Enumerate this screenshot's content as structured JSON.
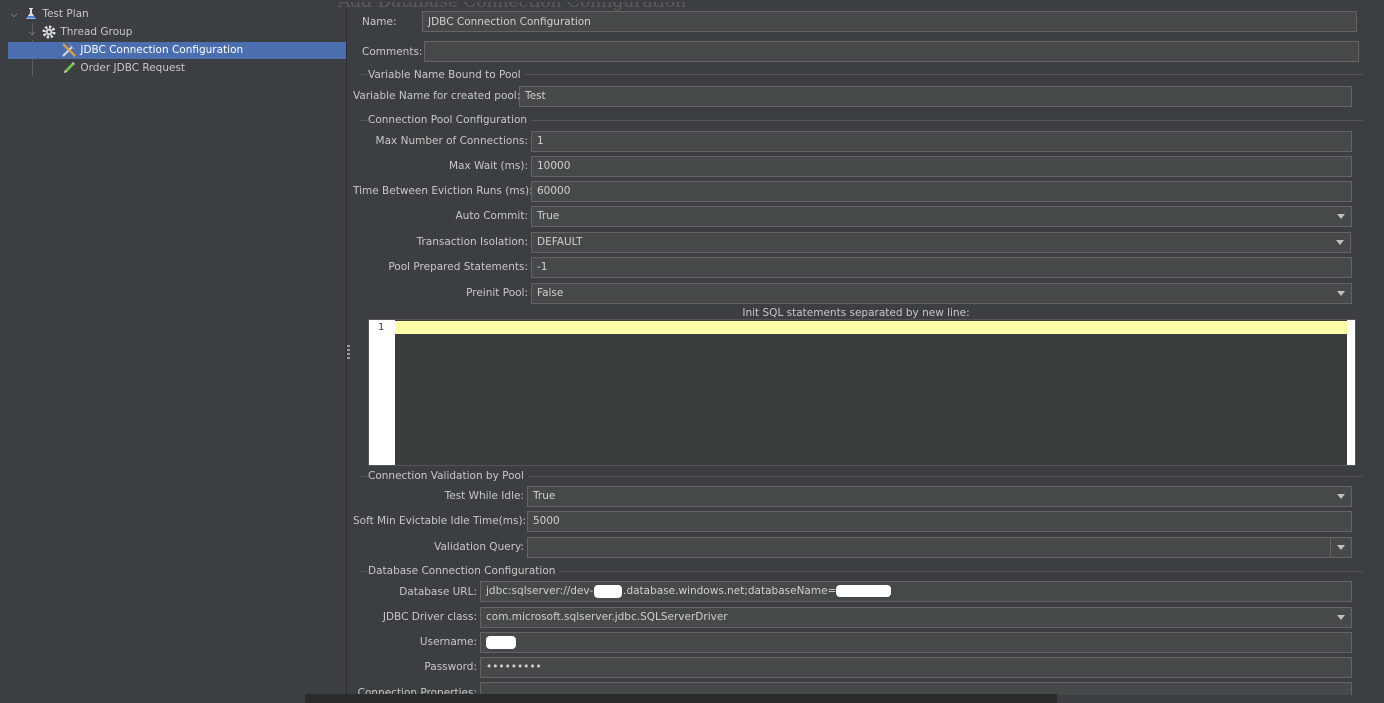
{
  "header": {
    "ghost_title": "Add Database Connection Configuration"
  },
  "tree": {
    "items": [
      {
        "label": "Test Plan",
        "icon": "flask-icon"
      },
      {
        "label": "Thread Group",
        "icon": "gear-icon"
      },
      {
        "label": "JDBC Connection Configuration",
        "icon": "wrench-icon",
        "selected": true
      },
      {
        "label": "Order JDBC Request",
        "icon": "pencil-icon"
      }
    ]
  },
  "form": {
    "name_label": "Name:",
    "name_value": "JDBC Connection Configuration",
    "comments_label": "Comments:",
    "comments_value": "",
    "variable_group": {
      "title": "Variable Name Bound to Pool",
      "pool_name_label": "Variable Name for created pool:",
      "pool_name_value": "Test"
    },
    "pool_group": {
      "title": "Connection Pool Configuration",
      "max_conn_label": "Max Number of Connections:",
      "max_conn_value": "1",
      "max_wait_label": "Max Wait (ms):",
      "max_wait_value": "10000",
      "eviction_label": "Time Between Eviction Runs (ms):",
      "eviction_value": "60000",
      "auto_commit_label": "Auto Commit:",
      "auto_commit_value": "True",
      "isolation_label": "Transaction Isolation:",
      "isolation_value": "DEFAULT",
      "prepared_label": "Pool Prepared Statements:",
      "prepared_value": "-1",
      "preinit_label": "Preinit Pool:",
      "preinit_value": "False",
      "init_sql_label": "Init SQL statements separated by new line:",
      "init_sql_line": "1"
    },
    "validation_group": {
      "title": "Connection Validation by Pool",
      "test_idle_label": "Test While Idle:",
      "test_idle_value": "True",
      "soft_min_label": "Soft Min Evictable Idle Time(ms):",
      "soft_min_value": "5000",
      "validation_query_label": "Validation Query:",
      "validation_query_value": ""
    },
    "db_group": {
      "title": "Database Connection Configuration",
      "url_label": "Database URL:",
      "url_part1": "jdbc:sqlserver://dev-",
      "url_part2": ".database.windows.net;databaseName=",
      "driver_label": "JDBC Driver class:",
      "driver_value": "com.microsoft.sqlserver.jdbc.SQLServerDriver",
      "username_label": "Username:",
      "password_label": "Password:",
      "password_value": "•••••••••",
      "conn_props_label": "Connection Properties:"
    }
  }
}
